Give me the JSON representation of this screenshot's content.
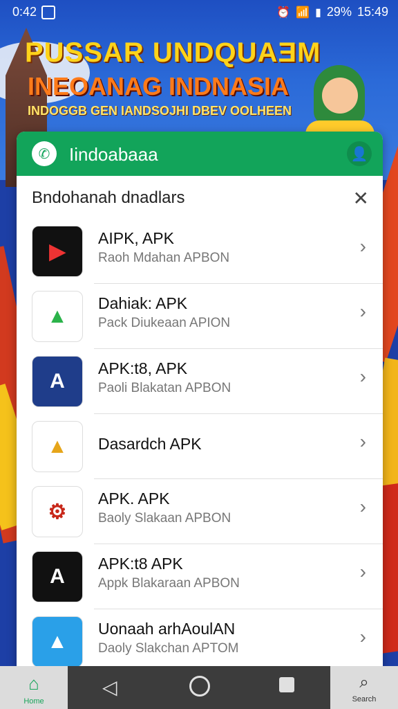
{
  "status": {
    "time_left": "0:42",
    "percent": "29%",
    "time_right": "15:49"
  },
  "banner": {
    "title1": "PUSSAR UNDQUAƎM",
    "title2": "INEOANAG INDNASIA",
    "title3": "INDOGGB GEN IANDSOJHI DBEV OOLHEEN"
  },
  "appbar": {
    "title": "Iindoabaaa"
  },
  "sheet": {
    "title": "Bndohanah dnadlars"
  },
  "apps": [
    {
      "name": "AIPK, APK",
      "sub": "Raoh Mdahan  APBON",
      "icon_color": "#111111",
      "icon_text": "▶"
    },
    {
      "name": "Dahiak: APK",
      "sub": "Pack Diukeaan  APION",
      "icon_color": "#ffffff",
      "icon_text": "▲"
    },
    {
      "name": "APK:t8, APK",
      "sub": "Paoli Blakatan  APBON",
      "icon_color": "#1f3d8a",
      "icon_text": "A"
    },
    {
      "name": "Dasardch APK",
      "sub": "",
      "icon_color": "#ffffff",
      "icon_text": "▲"
    },
    {
      "name": "APK. APK",
      "sub": "Baoly Slakaan  APBON",
      "icon_color": "#ffffff",
      "icon_text": "⚙"
    },
    {
      "name": "APK:t8 APK",
      "sub": "Appk Blakaraan  APBON",
      "icon_color": "#111111",
      "icon_text": "A"
    },
    {
      "name": "Uonaah arhAoulAN",
      "sub": "Daoly Slakchan  APTOM",
      "icon_color": "#2aa0e8",
      "icon_text": "▲"
    }
  ],
  "nav": {
    "home_label": "Home",
    "search_label": "Search"
  },
  "colors": {
    "accent_green": "#12a45a",
    "banner_yellow": "#ffd31a"
  }
}
